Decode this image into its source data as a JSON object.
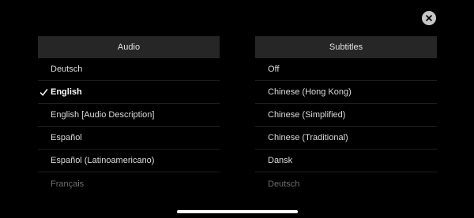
{
  "colors": {
    "background": "#000000",
    "header_background": "#262626",
    "text": "#dcdcdc",
    "selected_text": "#ffffff",
    "faded_text": "#6e6e6e",
    "close_button": "#c8c8c8"
  },
  "icons": {
    "close": "close-icon",
    "check": "checkmark-icon"
  },
  "audio": {
    "header": "Audio",
    "items": [
      {
        "label": "Deutsch"
      },
      {
        "label": "English",
        "selected": true
      },
      {
        "label": "English [Audio Description]"
      },
      {
        "label": "Español"
      },
      {
        "label": "Español (Latinoamericano)"
      },
      {
        "label": "Français"
      }
    ]
  },
  "subtitles": {
    "header": "Subtitles",
    "items": [
      {
        "label": "Off"
      },
      {
        "label": "Chinese (Hong Kong)"
      },
      {
        "label": "Chinese (Simplified)"
      },
      {
        "label": "Chinese (Traditional)"
      },
      {
        "label": "Dansk"
      },
      {
        "label": "Deutsch"
      }
    ]
  }
}
